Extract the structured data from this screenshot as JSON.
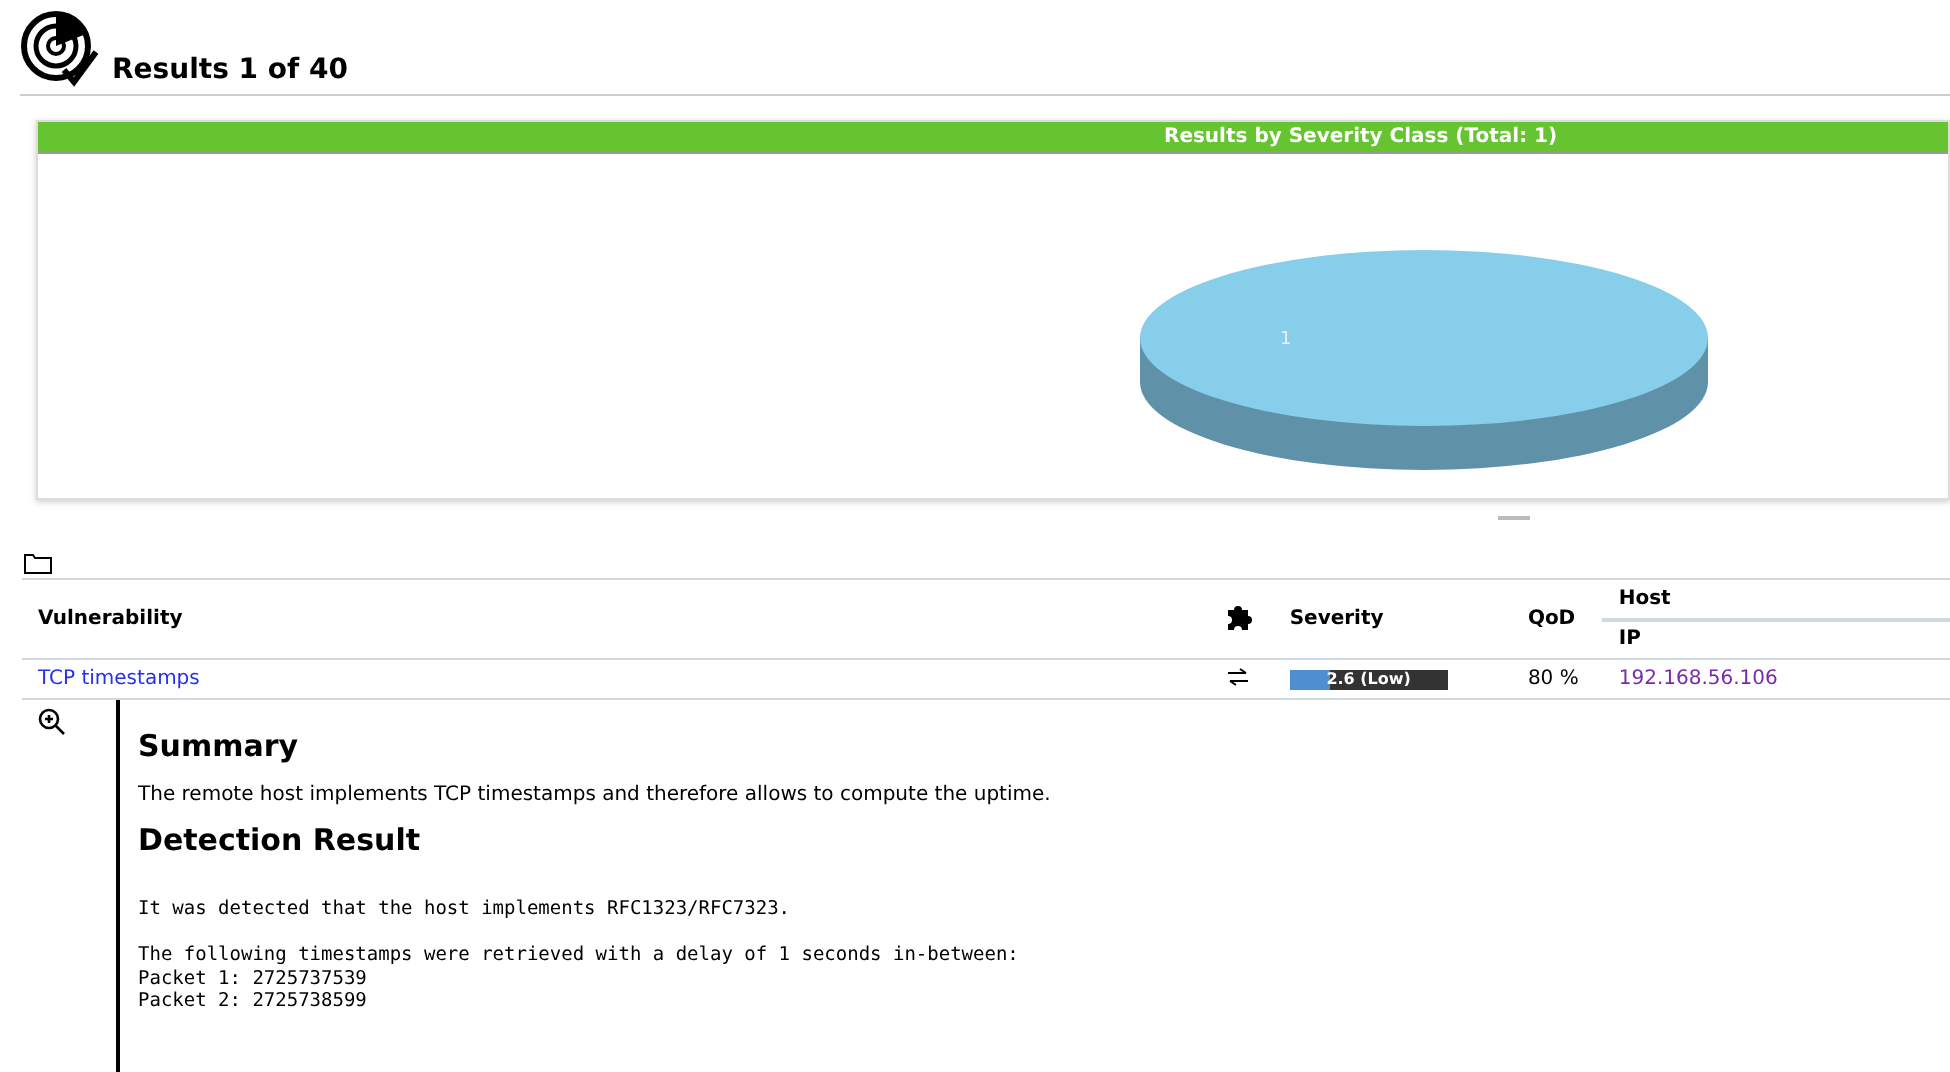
{
  "page": {
    "title": "Results 1 of 40"
  },
  "chart": {
    "title": "Results by Severity Class (Total: 1)",
    "slice_label": "1"
  },
  "table": {
    "columns": [
      {
        "kind": "text",
        "label": "Vulnerability"
      },
      {
        "kind": "icon"
      },
      {
        "kind": "text",
        "label": "Severity"
      },
      {
        "kind": "text",
        "label": "QoD"
      },
      {
        "kind": "group",
        "label": "Host",
        "sub": "IP"
      }
    ],
    "rows": [
      {
        "vulnerability": "TCP timestamps",
        "severity": {
          "level": 0.26,
          "label": "2.6 (Low)"
        },
        "qod": "80 %",
        "ip": "192.168.56.106"
      }
    ]
  },
  "details": {
    "sections": [
      {
        "kind": "text",
        "heading": "Summary",
        "body": [
          "The remote host implements TCP timestamps and therefore allows to compute the uptime."
        ]
      },
      {
        "kind": "pre",
        "heading": "Detection Result",
        "body": [
          "It was detected that the host implements RFC1323/RFC7323.",
          "The following timestamps were retrieved with a delay of 1 seconds in-between:\nPacket 1: 2725737539\nPacket 2: 2725738599"
        ]
      }
    ]
  }
}
